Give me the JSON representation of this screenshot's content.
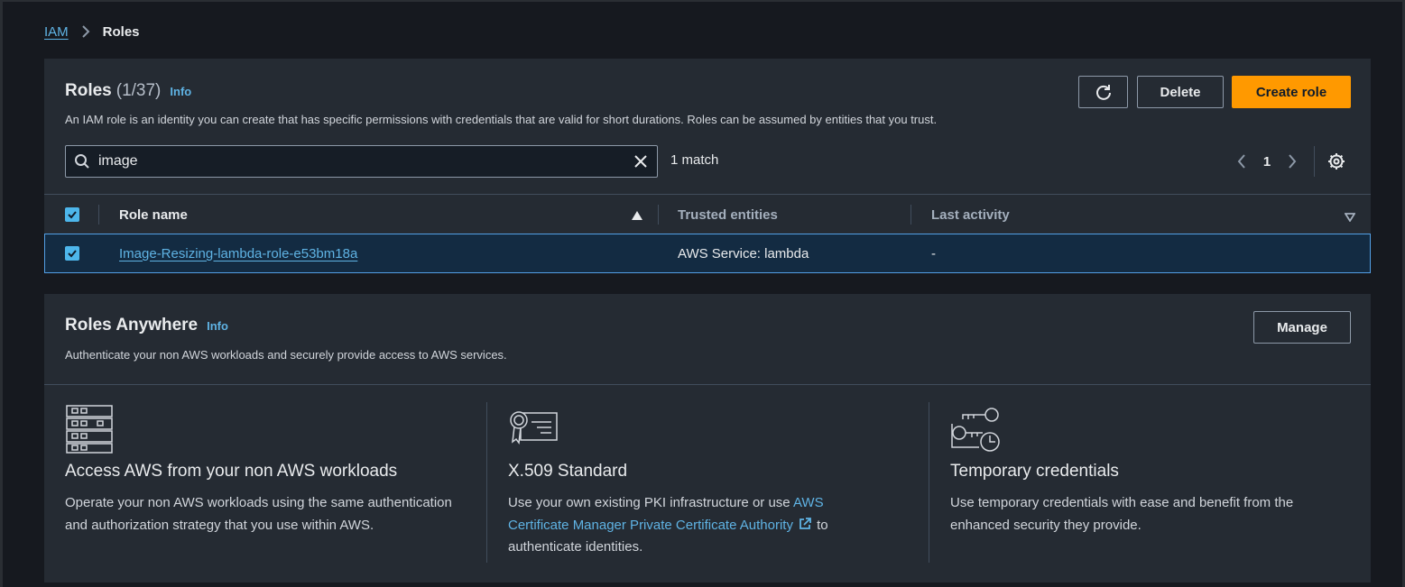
{
  "breadcrumb": {
    "root": "IAM",
    "current": "Roles"
  },
  "roles": {
    "title": "Roles",
    "count": "(1/37)",
    "info": "Info",
    "description": "An IAM role is an identity you can create that has specific permissions with credentials that are valid for short durations. Roles can be assumed by entities that you trust.",
    "delete_label": "Delete",
    "create_label": "Create role",
    "search": {
      "value": "image",
      "placeholder": ""
    },
    "match_text": "1 match",
    "page": "1",
    "columns": [
      "Role name",
      "Trusted entities",
      "Last activity"
    ],
    "rows": [
      {
        "name": "Image-Resizing-lambda-role-e53bm18a",
        "trusted": "AWS Service: lambda",
        "last_activity": "-",
        "selected": true
      }
    ]
  },
  "anywhere": {
    "title": "Roles Anywhere",
    "info": "Info",
    "description": "Authenticate your non AWS workloads and securely provide access to AWS services.",
    "manage_label": "Manage",
    "features": [
      {
        "icon": "server-stack-icon",
        "title": "Access AWS from your non AWS workloads",
        "text": "Operate your non AWS workloads using the same authentication and authorization strategy that you use within AWS."
      },
      {
        "icon": "certificate-icon",
        "title": "X.509 Standard",
        "text_before": "Use your own existing PKI infrastructure or use ",
        "link": "AWS Certificate Manager Private Certificate Authority",
        "text_after": " to authenticate identities."
      },
      {
        "icon": "keys-clock-icon",
        "title": "Temporary credentials",
        "text": "Use temporary credentials with ease and benefit from the enhanced security they provide."
      }
    ]
  },
  "colors": {
    "accent": "#ff9900",
    "link": "#5fb3e4",
    "selection": "#539fe5",
    "background": "#16191f",
    "panel": "#252b33"
  }
}
